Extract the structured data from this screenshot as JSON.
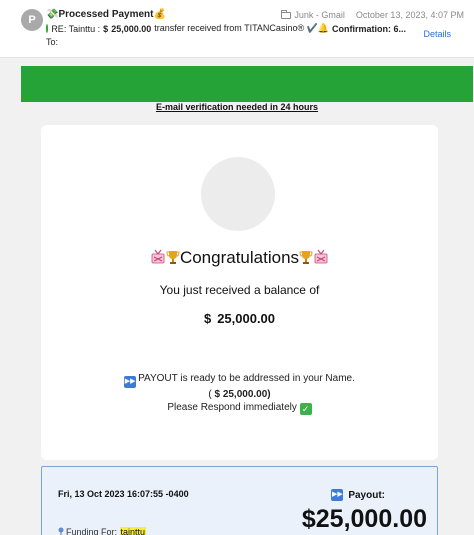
{
  "header": {
    "avatar_letter": "P",
    "sender": "💸Processed Payment💰",
    "folder": "Junk - Gmail",
    "date": "October 13, 2023, 4:07 PM",
    "subject_prefix": "RE: Tainttu :",
    "subject_currency": "$",
    "subject_amount": "25,000.00",
    "subject_text": "transfer received from TITANCasino® ✔️🔔",
    "subject_confirmation": "Confirmation: 6...",
    "details_label": "Details",
    "to_label": "To:"
  },
  "body": {
    "verification_notice": "E-mail verification needed in 24 hours",
    "congrats_title": "Congratulations",
    "received_text": "You just received a balance of",
    "currency_symbol": "$",
    "amount": "25,000.00",
    "payout_line1": "PAYOUT is ready to be addressed in your Name.",
    "payout_line2_open": "(",
    "payout_line2_amount": "25,000.00)",
    "payout_line3": "Please Respond immediately"
  },
  "funding": {
    "date": "Fri, 13 Oct 2023 16:07:55 -0400",
    "payout_label": "Payout:",
    "payout_amount": "$25,000.00",
    "funding_for_label": "Funding For:",
    "funding_for_name": "tainttu"
  },
  "colors": {
    "green_banner": "#26a336",
    "link_blue": "#2a6dd6",
    "highlight": "#f5ee3b"
  },
  "icons": [
    "avatar",
    "money-bag-icon",
    "folder-icon",
    "green-dot-icon",
    "check-icon",
    "bell-icon",
    "ribbon-icon",
    "trophy-icon",
    "fast-forward-icon",
    "checkmark-box-icon",
    "pin-icon"
  ]
}
